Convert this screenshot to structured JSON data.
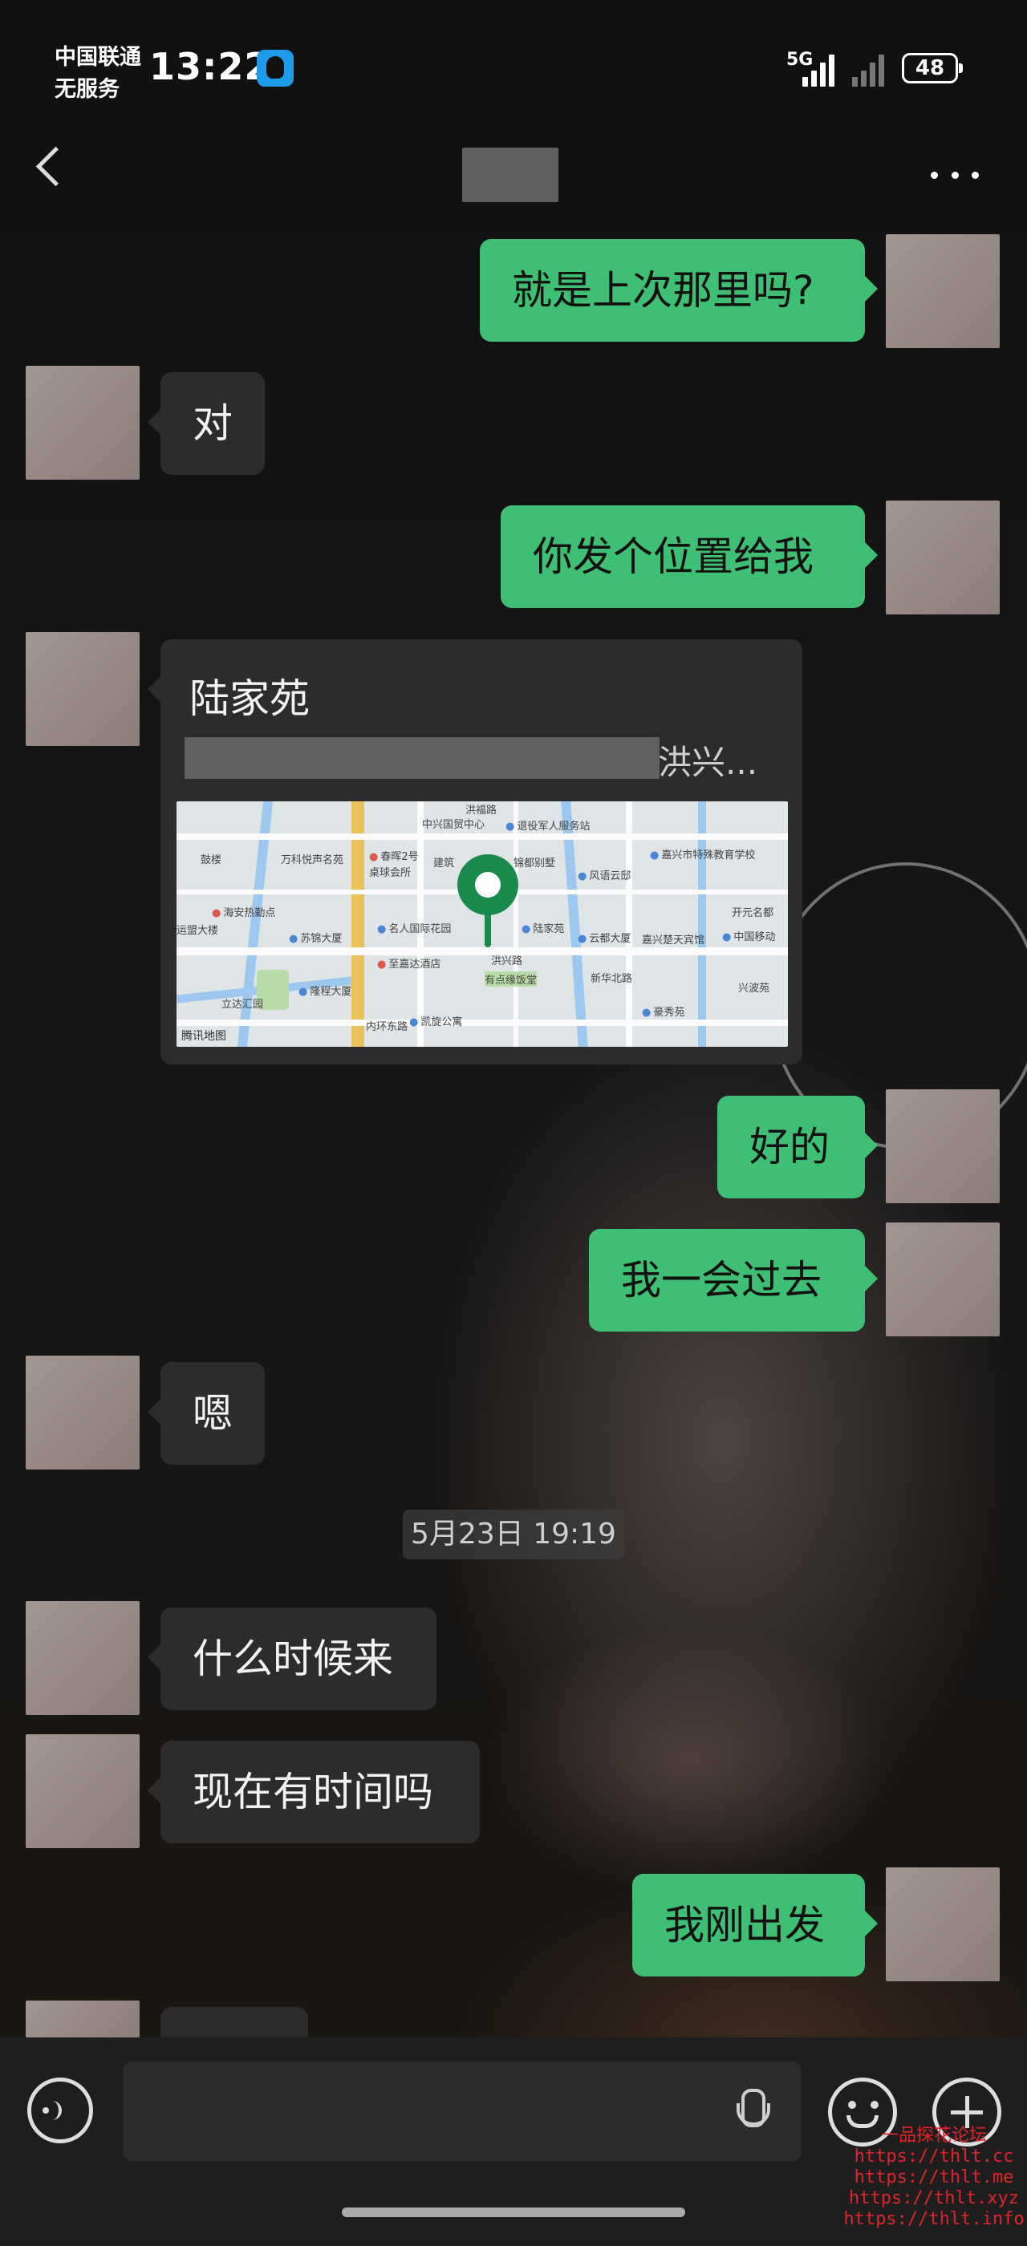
{
  "status_bar": {
    "carrier_line1": "中国联通",
    "carrier_line2": "无服务",
    "time": "13:22",
    "network": "5G",
    "battery": "48"
  },
  "nav": {
    "back_icon": "chevron-left-icon",
    "title": "",
    "more_icon": "more-horizontal-icon"
  },
  "messages": [
    {
      "from": "me",
      "text": "就是上次那里吗?"
    },
    {
      "from": "other",
      "text": "对"
    },
    {
      "from": "me",
      "text": "你发个位置给我"
    },
    {
      "from": "other",
      "type": "location",
      "name": "陆家苑",
      "address_visible": "洪兴...",
      "map_labels": [
        "中兴国贸中心",
        "退役军人服务站",
        "洪福路",
        "鼓楼",
        "万科悦声名苑",
        "春晖2号",
        "建筑",
        "锦都别墅",
        "风语云邸",
        "嘉兴市特殊教育学校",
        "桌球会所",
        "陆家苑",
        "海安热勤点",
        "苏锦大厦",
        "名人国际花园",
        "云都大厦",
        "嘉兴楚天宾馆",
        "中国移动",
        "开元名都",
        "运盟大楼",
        "至嘉达酒店",
        "有点缘饭堂",
        "洪兴路",
        "兴波苑",
        "立达汇园",
        "隆程大厦",
        "凯旋公寓",
        "豪秀苑",
        "内环东路",
        "新华北路"
      ],
      "map_brand": "腾讯地图"
    },
    {
      "from": "me",
      "text": "好的"
    },
    {
      "from": "me",
      "text": "我一会过去"
    },
    {
      "from": "other",
      "text": "嗯"
    },
    {
      "type": "timestamp",
      "text": "5月23日 19:19"
    },
    {
      "from": "other",
      "text": "什么时候来"
    },
    {
      "from": "other",
      "text": "现在有时间吗"
    },
    {
      "from": "me",
      "text": "我刚出发"
    }
  ],
  "input_bar": {
    "voice_icon": "voice-input-icon",
    "text_value": "",
    "mic_icon": "microphone-icon",
    "emoji_icon": "emoji-icon",
    "plus_icon": "plus-icon"
  },
  "watermark": {
    "title": "一品探花论坛",
    "urls": [
      "https://thlt.cc",
      "https://thlt.me",
      "https://thlt.xyz",
      "https://thlt.info"
    ]
  },
  "colors": {
    "my_bubble": "#3fbf75",
    "their_bubble": "#2c2c2c",
    "background": "#111111",
    "map_pin": "#1a8a4c",
    "watermark": "#e0242c"
  }
}
